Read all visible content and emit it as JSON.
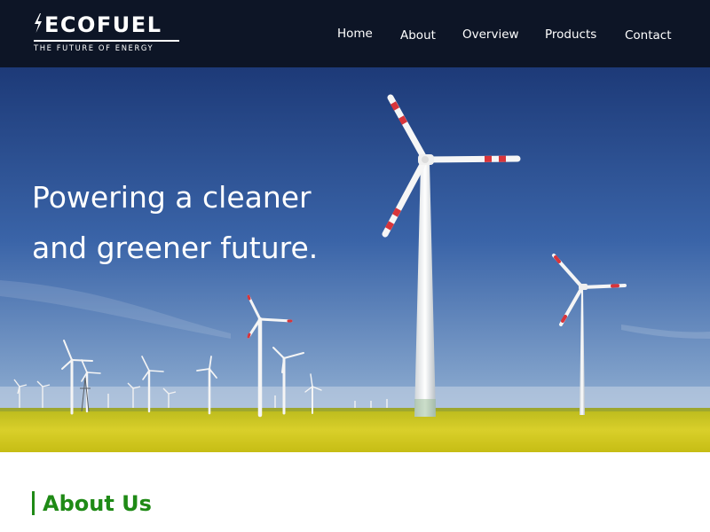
{
  "brand": {
    "name": "ECOFUEL",
    "tagline": "THE FUTURE OF ENERGY",
    "logo_icon": "lightning-bolt-icon"
  },
  "nav": {
    "items": [
      {
        "label": "Home"
      },
      {
        "label": "About"
      },
      {
        "label": "Overview"
      },
      {
        "label": "Products"
      },
      {
        "label": "Contact"
      }
    ]
  },
  "hero": {
    "headline_line1": "Powering a cleaner",
    "headline_line2": "and greener future.",
    "image": "wind-turbines-over-rapeseed-field"
  },
  "about": {
    "heading": "About Us"
  },
  "colors": {
    "header_bg": "#0d1526",
    "accent_green": "#1f8a16",
    "text_white": "#ffffff"
  }
}
